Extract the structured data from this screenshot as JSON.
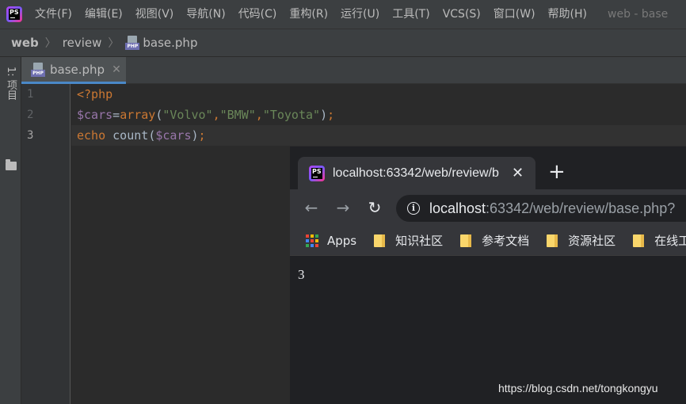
{
  "menubar": {
    "items": [
      "文件(F)",
      "编辑(E)",
      "视图(V)",
      "导航(N)",
      "代码(C)",
      "重构(R)",
      "运行(U)",
      "工具(T)",
      "VCS(S)",
      "窗口(W)",
      "帮助(H)"
    ],
    "window_title": "web - base"
  },
  "breadcrumb": {
    "project": "web",
    "folder": "review",
    "file": "base.php"
  },
  "toolstrip": {
    "project_label": "1: 项目"
  },
  "editor": {
    "tab_label": "base.php",
    "line_numbers": [
      "1",
      "2",
      "3"
    ],
    "current_line": 3,
    "code": {
      "line1": {
        "open_tag": "<?php"
      },
      "line2": {
        "var": "$cars",
        "eq": "=",
        "fn": "array",
        "p_open": "(",
        "s1": "\"Volvo\"",
        "c1": ",",
        "s2": "\"BMW\"",
        "c2": ",",
        "s3": "\"Toyota\"",
        "p_close": ")",
        "semi": ";"
      },
      "line3": {
        "kw": "echo",
        "sp": " ",
        "fn": "count",
        "p_open": "(",
        "var": "$cars",
        "p_close": ")",
        "semi": ";"
      }
    }
  },
  "browser": {
    "tab_title": "localhost:63342/web/review/b",
    "tab_close": "✕",
    "new_tab": "+",
    "url_host": "localhost",
    "url_rest": ":63342/web/review/base.php?",
    "bookmarks": {
      "apps": "Apps",
      "folders": [
        "知识社区",
        "参考文档",
        "资源社区",
        "在线工"
      ]
    },
    "page_output": "3"
  },
  "watermark": "https://blog.csdn.net/tongkongyu",
  "colors": {
    "keyword": "#cc7832",
    "variable": "#9876aa",
    "string": "#6a8759",
    "function": "#ffc66d",
    "tab_underline": "#4a88c7"
  }
}
